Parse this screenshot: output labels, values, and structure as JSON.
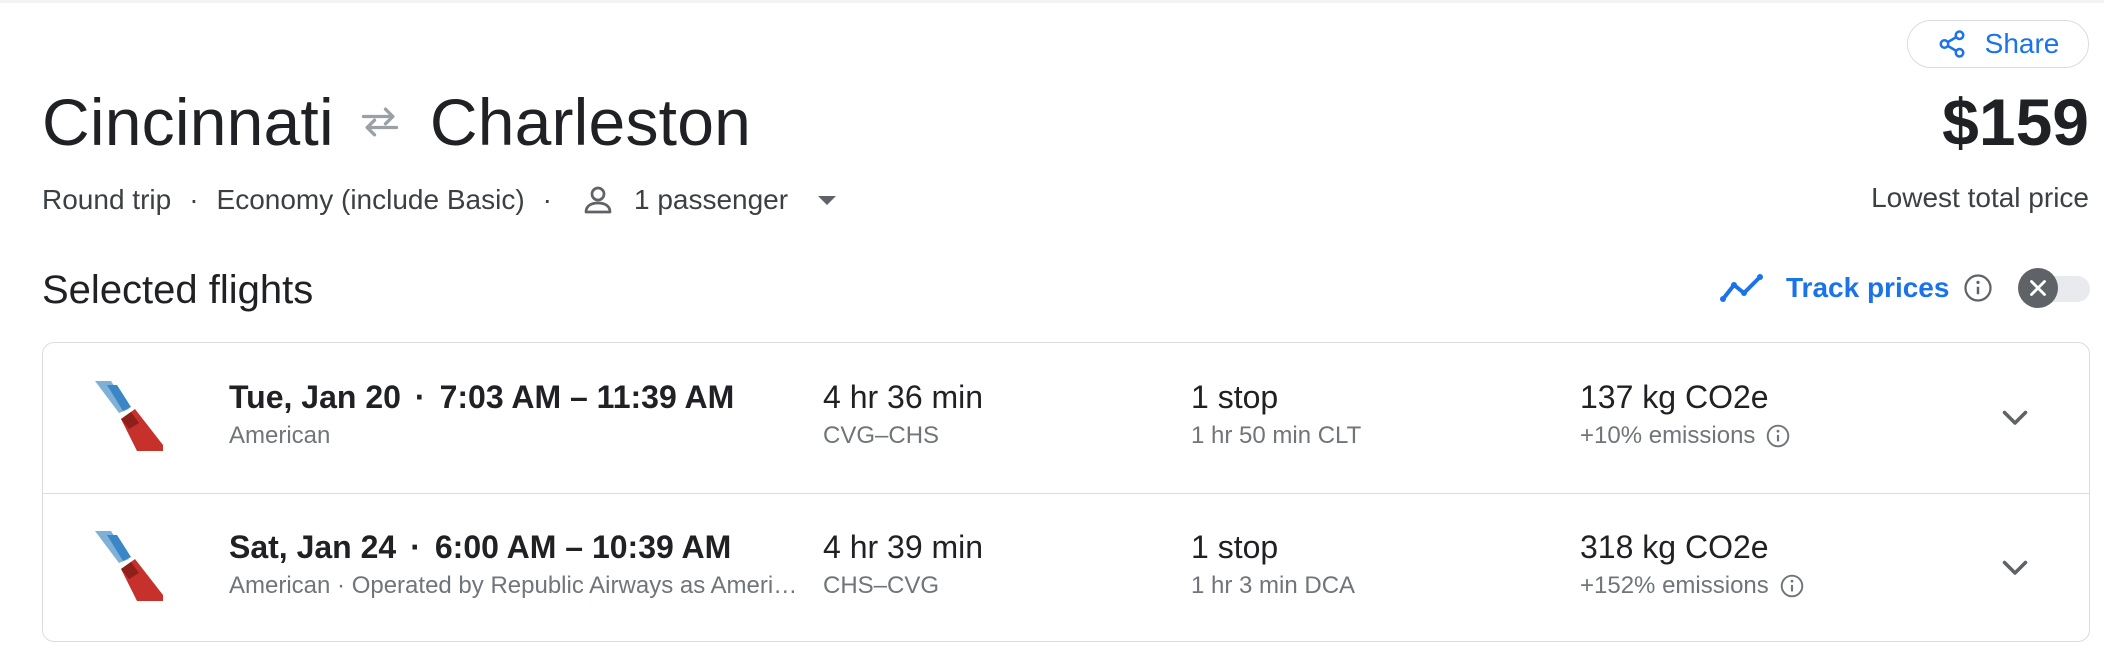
{
  "header": {
    "share_label": "Share",
    "origin": "Cincinnati",
    "destination": "Charleston",
    "price": "$159",
    "price_label": "Lowest total price",
    "trip_type": "Round trip",
    "cabin_class": "Economy (include Basic)",
    "passengers": "1 passenger",
    "separator": "·"
  },
  "selected": {
    "title": "Selected flights",
    "track_label": "Track prices",
    "track_enabled": false
  },
  "flights": [
    {
      "date": "Tue, Jan 20",
      "times": "7:03 AM – 11:39 AM",
      "airline": "American",
      "duration": "4 hr 36 min",
      "route": "CVG–CHS",
      "stops": "1 stop",
      "layover": "1 hr 50 min CLT",
      "emissions": "137 kg CO2e",
      "emissions_delta": "+10% emissions"
    },
    {
      "date": "Sat, Jan 24",
      "times": "6:00 AM – 10:39 AM",
      "airline": "American · Operated by Republic Airways as American Eagle",
      "duration": "4 hr 39 min",
      "route": "CHS–CVG",
      "stops": "1 stop",
      "layover": "1 hr 3 min DCA",
      "emissions": "318 kg CO2e",
      "emissions_delta": "+152% emissions"
    }
  ],
  "colors": {
    "accent": "#1a73e8",
    "text": "#202124",
    "secondary_text": "#70757a",
    "border": "#dadce0"
  },
  "icons": [
    "share-icon",
    "swap-arrows-icon",
    "person-icon",
    "dropdown-caret-icon",
    "trend-icon",
    "info-icon",
    "close-icon",
    "american-airlines-logo",
    "chevron-down-icon"
  ]
}
